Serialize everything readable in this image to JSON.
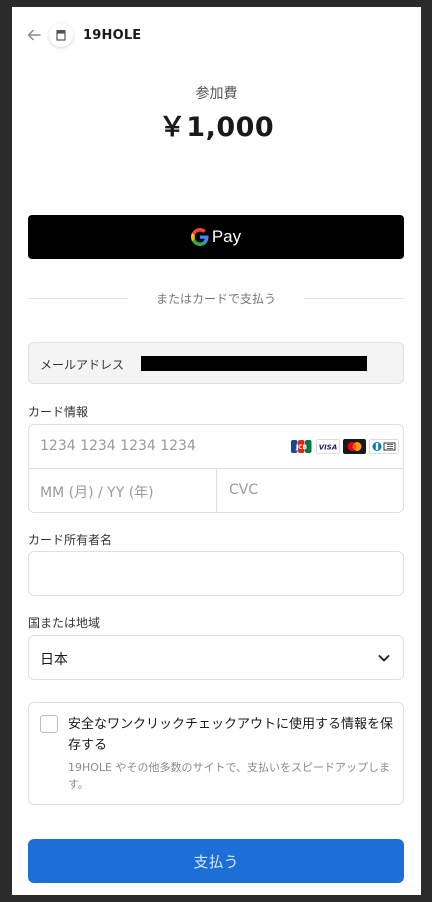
{
  "header": {
    "store_name": "19HOLE"
  },
  "summary": {
    "label": "参加費",
    "amount": "￥1,000"
  },
  "wallet": {
    "gpay_label": "Pay"
  },
  "divider": {
    "text": "またはカードで支払う"
  },
  "email": {
    "label": "メールアドレス"
  },
  "card": {
    "label": "カード情報",
    "number_placeholder": "1234 1234 1234 1234",
    "expiry_placeholder": "MM (月) / YY (年)",
    "cvc_placeholder": "CVC",
    "brands": [
      "JCB",
      "VISA",
      "Mastercard",
      "Diners Club"
    ]
  },
  "holder": {
    "label": "カード所有者名",
    "value": ""
  },
  "country": {
    "label": "国または地域",
    "value": "日本"
  },
  "save": {
    "title": "安全なワンクリックチェックアウトに使用する情報を保存する",
    "description": "19HOLE やその他多数のサイトで、支払いをスピードアップします。",
    "checked": false
  },
  "pay_button": {
    "label": "支払う"
  },
  "colors": {
    "primary": "#1c6fd6",
    "gpay_bg": "#000000"
  }
}
